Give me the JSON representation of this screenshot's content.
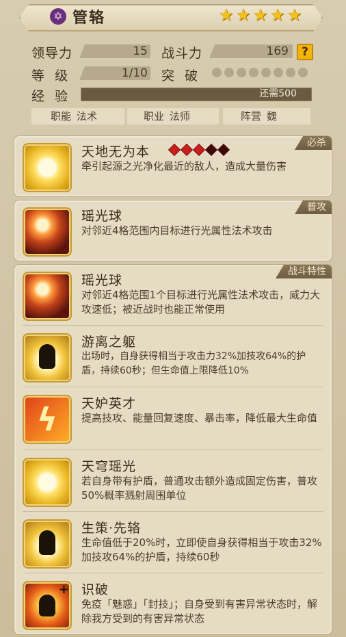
{
  "hero": {
    "name": "管辂",
    "icon": "purple-star-badge-icon",
    "stars": 5
  },
  "stats": {
    "leadership_label": "领导力",
    "leadership_value": "15",
    "power_label": "战斗力",
    "power_value": "169",
    "help_icon": "?",
    "level_label": "等  级",
    "level_value": "1/10",
    "breakthrough_label": "突  破",
    "breakthrough_dots": 8,
    "exp_label": "经  验",
    "exp_text": "还需500"
  },
  "tags": {
    "function_label": "职能",
    "function_value": "法术",
    "class_label": "职业",
    "class_value": "法师",
    "faction_label": "阵营",
    "faction_value": "魏"
  },
  "panels": {
    "ultimate": {
      "badge": "必杀",
      "name": "天地无为本",
      "gems_filled": 3,
      "gems_total": 5,
      "desc": "牵引起源之光净化最近的敌人，造成大量伤害",
      "icon": "radiant-light-icon"
    },
    "normal": {
      "badge": "普攻",
      "name": "瑶光球",
      "desc": "对邻近4格范围内目标进行光属性法术攻击",
      "icon": "light-orb-icon"
    },
    "traits": {
      "badge": "战斗特性",
      "items": [
        {
          "name": "瑶光球",
          "desc": "对邻近4格范围1个目标进行光属性法术攻击，威力大攻速低；被近战时也能正常使用",
          "icon": "light-orb-icon"
        },
        {
          "name": "游离之躯",
          "desc": "出场时，自身获得相当于攻击力32%加技攻64%的护盾，持续60秒；但生命值上限降低10%",
          "icon": "shadow-figure-icon"
        },
        {
          "name": "天妒英才",
          "desc": "提高技攻、能量回复速度、暴击率，降低最大生命值",
          "icon": "lightning-icon"
        },
        {
          "name": "天穹瑶光",
          "desc": "若自身带有护盾，普通攻击额外造成固定伤害，普攻50%概率溅射周围单位",
          "icon": "radiant-light-icon"
        },
        {
          "name": "生策·先辂",
          "desc": "生命值低于20%时，立即使自身获得相当于攻击32%加技攻64%的护盾，持续60秒",
          "icon": "shadow-figure-icon"
        },
        {
          "name": "识破",
          "desc": "免疫「魅惑」「封技」；自身受到有害异常状态时，解除我方受到的有害异常状态",
          "icon": "dispel-burst-icon"
        }
      ]
    }
  },
  "colors": {
    "background": "#cfc3a6",
    "panel": "#e6dcc3",
    "badge": "#7a6649",
    "star": "#f5c21a",
    "gem_red": "#c81e1e"
  }
}
